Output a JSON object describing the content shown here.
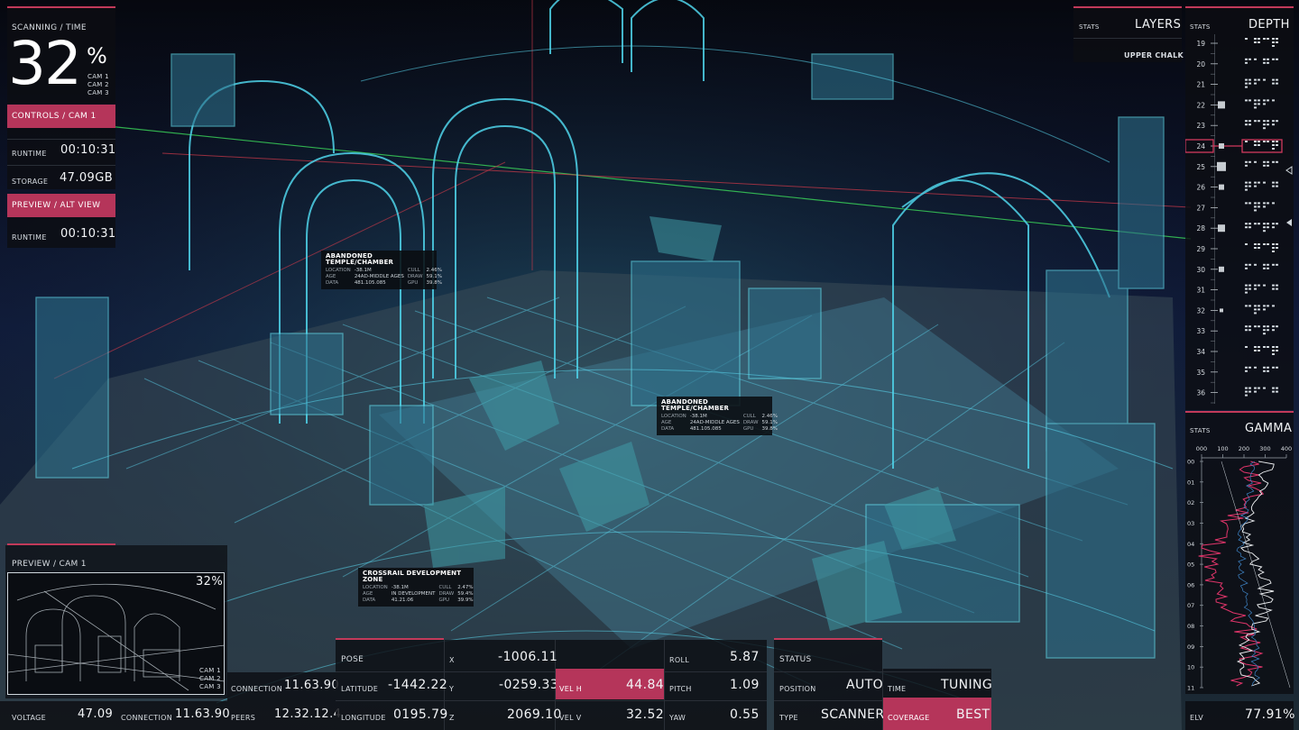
{
  "colors": {
    "accent": "#b5355a",
    "wire": "#3fd0e6",
    "panel": "#0c0e12"
  },
  "scan": {
    "header": "SCANNING / TIME",
    "percent": "32",
    "percent_sign": "%",
    "cams": [
      "CAM 1",
      "CAM 2",
      "CAM 3"
    ]
  },
  "controls": {
    "title": "CONTROLS / CAM 1",
    "runtime_label": "RUNTIME",
    "runtime_value": "00:10:31",
    "storage_label": "STORAGE",
    "storage_value": "47.09GB"
  },
  "alt_view": {
    "title": "PREVIEW / ALT VIEW",
    "runtime_label": "RUNTIME",
    "runtime_value": "00:10:31"
  },
  "preview": {
    "title": "PREVIEW / CAM 1",
    "percent": "32%",
    "cams": [
      "CAM 1",
      "CAM 2",
      "CAM 3"
    ]
  },
  "bottom_left": {
    "voltage_label": "VOLTAGE",
    "voltage_value": "47.09",
    "connection_label": "CONNECTION",
    "connection_value": "11.63.90",
    "connection2_label": "CONNECTION",
    "connection2_value": "11.63.90",
    "peers_label": "PEERS",
    "peers_value": "12.32.12.4"
  },
  "pose": {
    "title": "POSE",
    "latitude_label": "LATITUDE",
    "latitude_value": "-1442.22",
    "longitude_label": "LONGITUDE",
    "longitude_value": "0195.79",
    "x_label": "X",
    "x_value": "-1006.11",
    "y_label": "Y",
    "y_value": "-0259.33",
    "z_label": "Z",
    "z_value": "2069.10",
    "velh_label": "VEL H",
    "velh_value": "44.84",
    "velv_label": "VEL V",
    "velv_value": "32.52",
    "roll_label": "ROLL",
    "roll_value": "5.87",
    "pitch_label": "PITCH",
    "pitch_value": "1.09",
    "yaw_label": "YAW",
    "yaw_value": "0.55"
  },
  "status": {
    "title": "STATUS",
    "position_label": "POSITION",
    "position_value": "AUTO",
    "type_label": "TYPE",
    "type_value": "SCANNER",
    "time_label": "TIME",
    "time_value": "TUNING",
    "coverage_label": "COVERAGE",
    "coverage_value": "BEST"
  },
  "layers": {
    "stats": "STATS",
    "title": "LAYERS",
    "item": "UPPER CHALK"
  },
  "depth": {
    "stats": "STATS",
    "title": "DEPTH",
    "ticks": [
      "19",
      "20",
      "21",
      "22",
      "23",
      "24",
      "25",
      "26",
      "27",
      "28",
      "29",
      "30",
      "31",
      "32",
      "33",
      "34",
      "35",
      "36"
    ],
    "selected": "24"
  },
  "gamma": {
    "stats": "STATS",
    "title": "GAMMA",
    "xticks": [
      "000",
      "100",
      "200",
      "300",
      "400"
    ],
    "yticks": [
      "00",
      "01",
      "02",
      "03",
      "04",
      "05",
      "06",
      "07",
      "08",
      "09",
      "10",
      "11"
    ],
    "elv_label": "ELV",
    "elv_value": "77.91%"
  },
  "tags": [
    {
      "title": "ABANDONED TEMPLE/CHAMBER",
      "rows": [
        [
          "LOCATION",
          "-38.1M",
          "CULL",
          "2.46%"
        ],
        [
          "AGE",
          "24AD-MIDDLE AGES",
          "DRAW",
          "59.1%"
        ],
        [
          "DATA",
          "481.105.085",
          "GPU",
          "39.8%"
        ]
      ]
    },
    {
      "title": "ABANDONED TEMPLE/CHAMBER",
      "rows": [
        [
          "LOCATION",
          "-38.1M",
          "CULL",
          "2.46%"
        ],
        [
          "AGE",
          "24AD-MIDDLE AGES",
          "DRAW",
          "59.1%"
        ],
        [
          "DATA",
          "481.105.085",
          "GPU",
          "39.8%"
        ]
      ]
    },
    {
      "title": "CROSSRAIL DEVELOPMENT ZONE",
      "rows": [
        [
          "LOCATION",
          "-38.1M",
          "CULL",
          "2.47%"
        ],
        [
          "AGE",
          "IN DEVELOPMENT",
          "DRAW",
          "59.4%"
        ],
        [
          "DATA",
          "41.21.06",
          "GPU",
          "39.9%"
        ]
      ]
    }
  ]
}
